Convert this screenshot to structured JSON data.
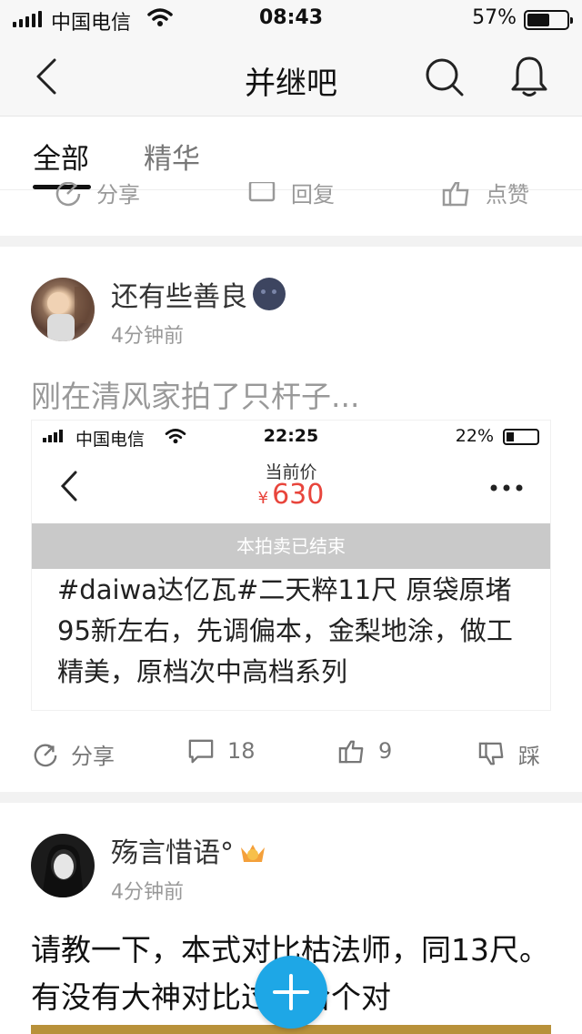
{
  "status_bar": {
    "carrier": "中国电信",
    "time": "08:43",
    "battery_percent": "57%",
    "battery_level": 0.57
  },
  "nav": {
    "title": "并继吧"
  },
  "tabs": [
    {
      "label": "全部",
      "active": true
    },
    {
      "label": "精华",
      "active": false
    }
  ],
  "prev_post_actions": {
    "share": "分享",
    "reply": "回复",
    "like": "点赞"
  },
  "posts": [
    {
      "username": "还有些善良",
      "emoji": "🌚",
      "time": "4分钟前",
      "title": "刚在清风家拍了只杆子...",
      "embed": {
        "carrier": "中国电信",
        "time": "22:25",
        "battery_percent": "22%",
        "price_label": "当前价",
        "currency": "¥",
        "price": "630",
        "ended": "本拍卖已结束",
        "description": "#daiwa达亿瓦#二天粹11尺 原袋原堵95新左右，先调偏本，金梨地涂，做工精美，原档次中高档系列"
      },
      "actions": {
        "share": "分享",
        "comments": "18",
        "likes": "9",
        "dislike": "踩"
      }
    },
    {
      "username": "殇言惜语°",
      "time": "4分钟前",
      "text": "请教一下，本式对比枯法师，同13尺。有没有大神对比过。给个对"
    }
  ],
  "colors": {
    "fab": "#1ea7e6",
    "price": "#e8453c"
  }
}
